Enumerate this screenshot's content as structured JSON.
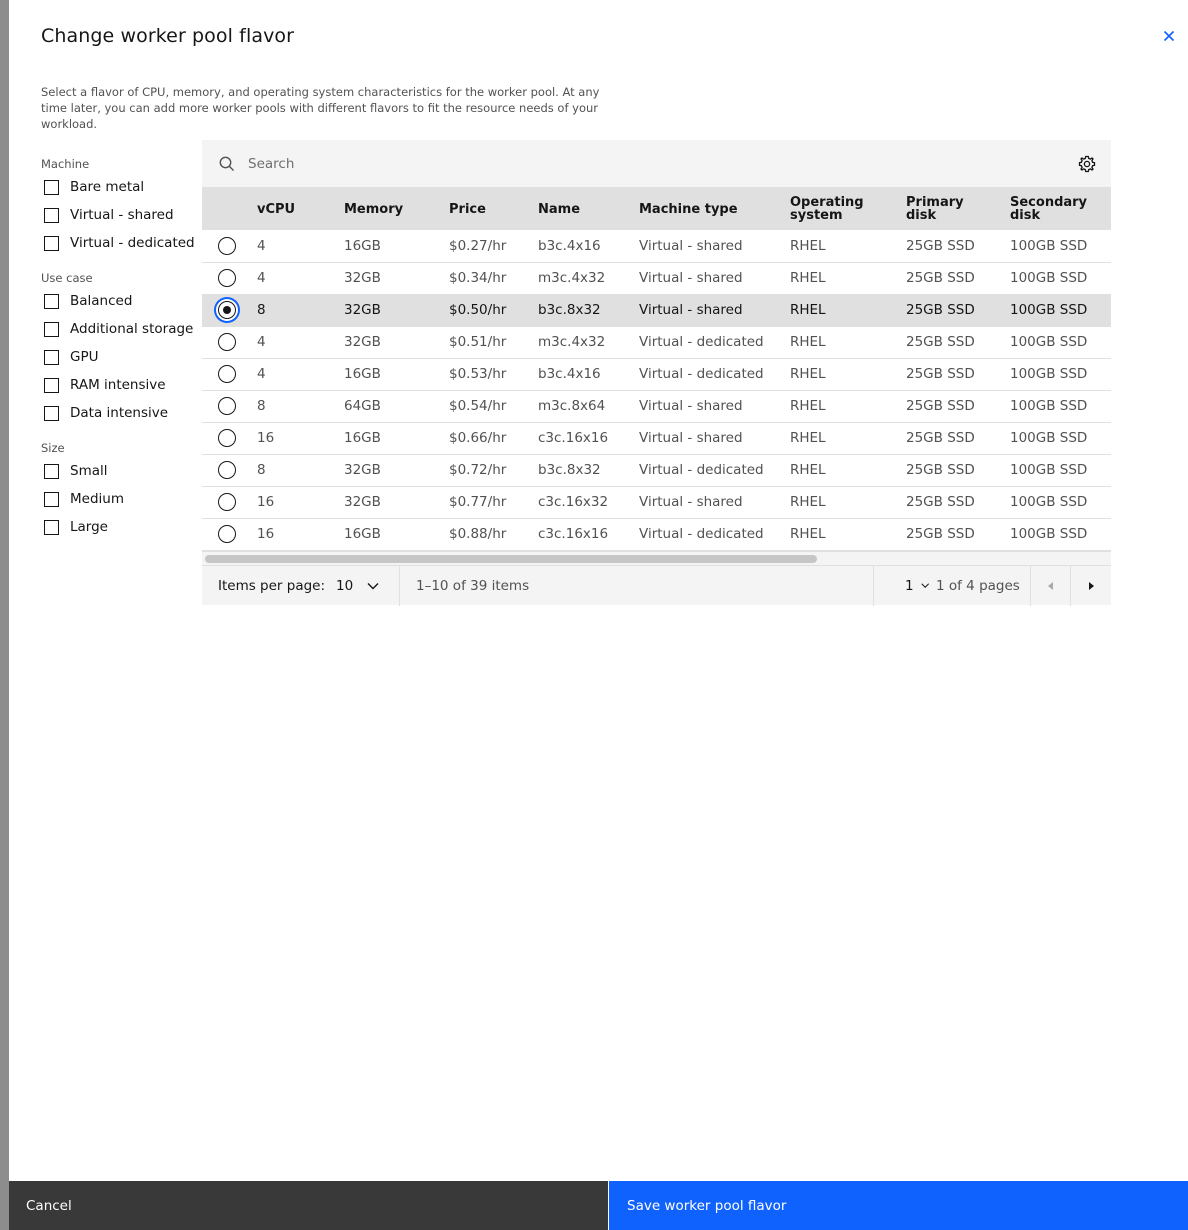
{
  "modal": {
    "title": "Change worker pool flavor",
    "description": "Select a flavor of CPU, memory, and operating system characteristics for the worker pool. At any time later, you can add more worker pools with different flavors to fit the resource needs of your workload."
  },
  "filters": {
    "machine": {
      "label": "Machine",
      "options": [
        "Bare metal",
        "Virtual - shared",
        "Virtual - dedicated"
      ]
    },
    "use_case": {
      "label": "Use case",
      "options": [
        "Balanced",
        "Additional storage",
        "GPU",
        "RAM intensive",
        "Data intensive"
      ]
    },
    "size": {
      "label": "Size",
      "options": [
        "Small",
        "Medium",
        "Large"
      ]
    }
  },
  "search": {
    "placeholder": "Search"
  },
  "table": {
    "headers": {
      "vcpu": "vCPU",
      "memory": "Memory",
      "price": "Price",
      "name": "Name",
      "machine_type": "Machine type",
      "os_line1": "Operating",
      "os_line2": "system",
      "primary_line1": "Primary",
      "primary_line2": "disk",
      "secondary_line1": "Secondary",
      "secondary_line2": "disk"
    },
    "selected_row_index": 2,
    "rows": [
      {
        "vcpu": "4",
        "memory": "16GB",
        "price": "$0.27/hr",
        "name": "b3c.4x16",
        "machine_type": "Virtual - shared",
        "os": "RHEL",
        "primary": "25GB SSD",
        "secondary": "100GB SSD"
      },
      {
        "vcpu": "4",
        "memory": "32GB",
        "price": "$0.34/hr",
        "name": "m3c.4x32",
        "machine_type": "Virtual - shared",
        "os": "RHEL",
        "primary": "25GB SSD",
        "secondary": "100GB SSD"
      },
      {
        "vcpu": "8",
        "memory": "32GB",
        "price": "$0.50/hr",
        "name": "b3c.8x32",
        "machine_type": "Virtual - shared",
        "os": "RHEL",
        "primary": "25GB SSD",
        "secondary": "100GB SSD"
      },
      {
        "vcpu": "4",
        "memory": "32GB",
        "price": "$0.51/hr",
        "name": "m3c.4x32",
        "machine_type": "Virtual - dedicated",
        "os": "RHEL",
        "primary": "25GB SSD",
        "secondary": "100GB SSD"
      },
      {
        "vcpu": "4",
        "memory": "16GB",
        "price": "$0.53/hr",
        "name": "b3c.4x16",
        "machine_type": "Virtual - dedicated",
        "os": "RHEL",
        "primary": "25GB SSD",
        "secondary": "100GB SSD"
      },
      {
        "vcpu": "8",
        "memory": "64GB",
        "price": "$0.54/hr",
        "name": "m3c.8x64",
        "machine_type": "Virtual - shared",
        "os": "RHEL",
        "primary": "25GB SSD",
        "secondary": "100GB SSD"
      },
      {
        "vcpu": "16",
        "memory": "16GB",
        "price": "$0.66/hr",
        "name": "c3c.16x16",
        "machine_type": "Virtual - shared",
        "os": "RHEL",
        "primary": "25GB SSD",
        "secondary": "100GB SSD"
      },
      {
        "vcpu": "8",
        "memory": "32GB",
        "price": "$0.72/hr",
        "name": "b3c.8x32",
        "machine_type": "Virtual - dedicated",
        "os": "RHEL",
        "primary": "25GB SSD",
        "secondary": "100GB SSD"
      },
      {
        "vcpu": "16",
        "memory": "32GB",
        "price": "$0.77/hr",
        "name": "c3c.16x32",
        "machine_type": "Virtual - shared",
        "os": "RHEL",
        "primary": "25GB SSD",
        "secondary": "100GB SSD"
      },
      {
        "vcpu": "16",
        "memory": "16GB",
        "price": "$0.88/hr",
        "name": "c3c.16x16",
        "machine_type": "Virtual - dedicated",
        "os": "RHEL",
        "primary": "25GB SSD",
        "secondary": "100GB SSD"
      }
    ]
  },
  "pagination": {
    "items_per_page_label": "Items per page:",
    "items_per_page_value": "10",
    "range_text": "1–10 of 39 items",
    "page_value": "1",
    "page_of_text": "1 of 4 pages"
  },
  "footer": {
    "cancel_label": "Cancel",
    "save_label": "Save worker pool flavor"
  },
  "colors": {
    "primary": "#0f62fe",
    "secondary_button": "#393939",
    "selected_row": "#e0e0e0",
    "toolbar_bg": "#f4f4f4"
  },
  "icons": {
    "close": "close-icon",
    "search": "search-icon",
    "settings": "settings-gear-icon",
    "dropdown": "chevron-down-icon",
    "prev": "caret-left-icon",
    "next": "caret-right-icon"
  }
}
